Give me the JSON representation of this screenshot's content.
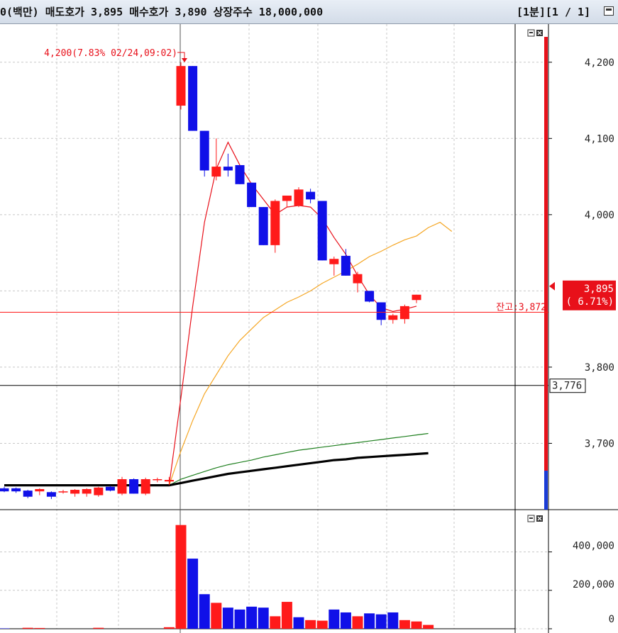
{
  "header": {
    "info": "0(백만) 매도호가 3,895 매수호가 3,890 상장주수 18,000,000",
    "period": "[1분][1 / 1]"
  },
  "colors": {
    "up": "#ff1a1a",
    "down": "#1010e8",
    "ma5": "#e8101a",
    "ma20": "#f5a623",
    "ma60": "#1e7f1e",
    "ma120": "#000000",
    "grid": "#c8c8c8"
  },
  "price_panel": {
    "annotation": "4,200(7.83% 02/24,09:02)",
    "balance_label": "잔고:3,872",
    "current_price": "3,895",
    "current_change": "( 6.71%)",
    "crosshair_price": "3,776",
    "y_ticks": [
      "4,200",
      "4,100",
      "4,000",
      "3,800",
      "3,700"
    ]
  },
  "volume_panel": {
    "y_ticks": [
      "400,000",
      "200,000",
      "0"
    ]
  },
  "chart_data": [
    {
      "type": "candlestick",
      "interval": "1 minute",
      "ylim": [
        3613,
        4250
      ],
      "y_ticks": [
        4200,
        4100,
        4000,
        3800,
        3700
      ],
      "balance_line": 3872,
      "current_price": 3895,
      "crosshair_value": 3776,
      "candles": [
        {
          "o": 3641,
          "h": 3643,
          "l": 3636,
          "c": 3637
        },
        {
          "o": 3641,
          "h": 3642,
          "l": 3635,
          "c": 3637
        },
        {
          "o": 3638,
          "h": 3639,
          "l": 3628,
          "c": 3630
        },
        {
          "o": 3637,
          "h": 3641,
          "l": 3632,
          "c": 3640
        },
        {
          "o": 3636,
          "h": 3637,
          "l": 3627,
          "c": 3630
        },
        {
          "o": 3636,
          "h": 3639,
          "l": 3634,
          "c": 3637
        },
        {
          "o": 3634,
          "h": 3640,
          "l": 3630,
          "c": 3639
        },
        {
          "o": 3634,
          "h": 3641,
          "l": 3630,
          "c": 3640
        },
        {
          "o": 3632,
          "h": 3643,
          "l": 3630,
          "c": 3642
        },
        {
          "o": 3643,
          "h": 3644,
          "l": 3637,
          "c": 3638
        },
        {
          "o": 3634,
          "h": 3656,
          "l": 3632,
          "c": 3653
        },
        {
          "o": 3653,
          "h": 3654,
          "l": 3634,
          "c": 3634
        },
        {
          "o": 3634,
          "h": 3655,
          "l": 3632,
          "c": 3653
        },
        {
          "o": 3652,
          "h": 3655,
          "l": 3649,
          "c": 3653
        },
        {
          "o": 3650,
          "h": 3656,
          "l": 3645,
          "c": 3652
        },
        {
          "o": 4143,
          "h": 4200,
          "l": 4138,
          "c": 4195
        },
        {
          "o": 4195,
          "h": 4195,
          "l": 4110,
          "c": 4110
        },
        {
          "o": 4110,
          "h": 4110,
          "l": 4050,
          "c": 4058
        },
        {
          "o": 4050,
          "h": 4100,
          "l": 4045,
          "c": 4063
        },
        {
          "o": 4063,
          "h": 4080,
          "l": 4050,
          "c": 4058
        },
        {
          "o": 4065,
          "h": 4065,
          "l": 4040,
          "c": 4040
        },
        {
          "o": 4042,
          "h": 4042,
          "l": 4010,
          "c": 4010
        },
        {
          "o": 4010,
          "h": 4010,
          "l": 3960,
          "c": 3960
        },
        {
          "o": 3960,
          "h": 4020,
          "l": 3950,
          "c": 4018
        },
        {
          "o": 4018,
          "h": 4024,
          "l": 4010,
          "c": 4025
        },
        {
          "o": 4012,
          "h": 4036,
          "l": 4010,
          "c": 4033
        },
        {
          "o": 4030,
          "h": 4034,
          "l": 4015,
          "c": 4020
        },
        {
          "o": 4018,
          "h": 4018,
          "l": 3940,
          "c": 3940
        },
        {
          "o": 3935,
          "h": 3945,
          "l": 3920,
          "c": 3942
        },
        {
          "o": 3946,
          "h": 3955,
          "l": 3920,
          "c": 3920
        },
        {
          "o": 3910,
          "h": 3925,
          "l": 3898,
          "c": 3922
        },
        {
          "o": 3900,
          "h": 3900,
          "l": 3885,
          "c": 3886
        },
        {
          "o": 3885,
          "h": 3885,
          "l": 3855,
          "c": 3862
        },
        {
          "o": 3862,
          "h": 3870,
          "l": 3857,
          "c": 3868
        },
        {
          "o": 3863,
          "h": 3882,
          "l": 3857,
          "c": 3880
        },
        {
          "o": 3888,
          "h": 3895,
          "l": 3884,
          "c": 3895
        }
      ],
      "ma": [
        {
          "period": 5,
          "color": "#e8101a",
          "x_start": 14,
          "values": [
            3645,
            3760,
            3880,
            3990,
            4060,
            4095,
            4065,
            4040,
            4020,
            4000,
            4010,
            4012,
            4010,
            3995,
            3970,
            3948,
            3920,
            3895,
            3878,
            3873,
            3876,
            3880
          ]
        },
        {
          "period": 20,
          "color": "#f5a623",
          "x_start": 14,
          "values": [
            3645,
            3690,
            3730,
            3765,
            3790,
            3815,
            3835,
            3850,
            3865,
            3875,
            3885,
            3892,
            3900,
            3910,
            3918,
            3926,
            3935,
            3945,
            3952,
            3960,
            3967,
            3972,
            3983,
            3990,
            3978
          ]
        },
        {
          "period": 60,
          "color": "#1e7f1e",
          "x_start": 14,
          "values": [
            3645,
            3653,
            3658,
            3663,
            3668,
            3672,
            3675,
            3678,
            3682,
            3685,
            3688,
            3691,
            3693,
            3695,
            3697,
            3699,
            3701,
            3703,
            3705,
            3707,
            3709,
            3711,
            3713
          ]
        },
        {
          "period": 120,
          "color": "#000000",
          "x_start": 0,
          "values": [
            3645,
            3645,
            3645,
            3645,
            3645,
            3645,
            3645,
            3645,
            3645,
            3645,
            3645,
            3645,
            3645,
            3645,
            3645,
            3648,
            3651,
            3654,
            3657,
            3660,
            3662,
            3664,
            3666,
            3668,
            3670,
            3672,
            3674,
            3676,
            3678,
            3679,
            3681,
            3682,
            3683,
            3684,
            3685,
            3686,
            3687
          ]
        }
      ]
    },
    {
      "type": "bar",
      "title": "volume",
      "ylim": [
        0,
        620000
      ],
      "y_ticks": [
        400000,
        200000,
        0
      ],
      "values": [
        2000,
        0,
        5000,
        4000,
        0,
        0,
        0,
        0,
        5000,
        0,
        0,
        0,
        0,
        0,
        8000,
        540000,
        365000,
        180000,
        135000,
        110000,
        100000,
        115000,
        110000,
        65000,
        140000,
        60000,
        45000,
        42000,
        100000,
        85000,
        65000,
        80000,
        75000,
        85000,
        45000,
        38000,
        20000
      ],
      "directions": [
        "down",
        "down",
        "up",
        "up",
        "up",
        "up",
        "up",
        "up",
        "up",
        "down",
        "up",
        "down",
        "up",
        "up",
        "up",
        "up",
        "down",
        "down",
        "up",
        "down",
        "down",
        "down",
        "down",
        "up",
        "up",
        "down",
        "up",
        "up",
        "down",
        "down",
        "up",
        "down",
        "down",
        "down",
        "up",
        "up",
        "up"
      ]
    }
  ]
}
